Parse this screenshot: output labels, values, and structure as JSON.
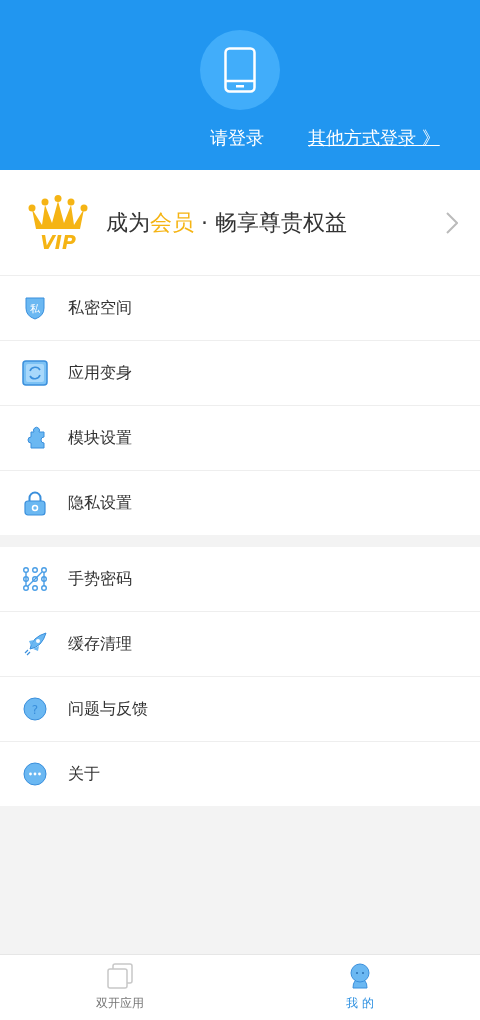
{
  "header": {
    "login": "请登录",
    "other_login": "其他方式登录 》"
  },
  "vip_banner": {
    "badge": "VIP",
    "prefix": "成为",
    "highlight": "会员",
    "suffix": " · 畅享尊贵权益"
  },
  "menu_groups": [
    [
      {
        "kind": "shield",
        "badge": "私",
        "label": "私密空间"
      },
      {
        "kind": "refresh",
        "label": "应用变身"
      },
      {
        "kind": "puzzle",
        "label": "模块设置"
      },
      {
        "kind": "lock",
        "label": "隐私设置"
      }
    ],
    [
      {
        "kind": "pattern",
        "label": "手势密码"
      },
      {
        "kind": "rocket",
        "label": "缓存清理"
      },
      {
        "kind": "question",
        "badge": "?",
        "label": "问题与反馈"
      },
      {
        "kind": "more",
        "label": "关于"
      }
    ]
  ],
  "bottom_nav": [
    {
      "kind": "apps",
      "label": "双开应用",
      "selected": false
    },
    {
      "kind": "me",
      "label": "我 的",
      "selected": true
    }
  ]
}
